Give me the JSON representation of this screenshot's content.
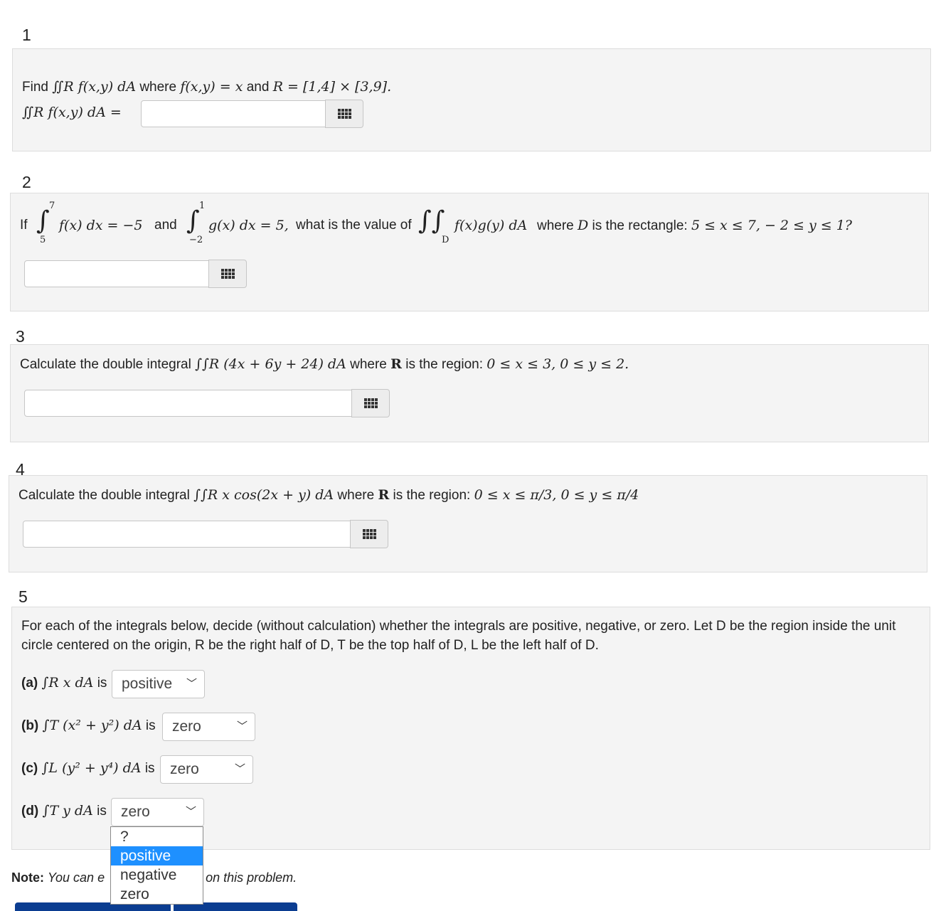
{
  "problems": {
    "p1": {
      "number": "1",
      "find": "Find",
      "integral_expr": "∬R f(x,y) dA",
      "where": "where",
      "f_def": "f(x,y) = x",
      "and": "and",
      "region": "R = [1,4] × [3,9].",
      "answer_prefix": "∬R f(x,y) dA =",
      "answer_value": ""
    },
    "p2": {
      "number": "2",
      "if": "If",
      "int1_upper": "7",
      "int1_lower": "5",
      "int1_body": "f(x) dx = −5",
      "and": "and",
      "int2_upper": "1",
      "int2_lower": "−2",
      "int2_body": "g(x) dx = 5,",
      "question": "what is the value of",
      "int3_sub": "D",
      "int3_body": "f(x)g(y) dA",
      "where_text": "where",
      "D": "D",
      "rect_text": "is the rectangle:",
      "ineq": "5 ≤ x ≤ 7,   − 2 ≤ y ≤ 1?",
      "answer_value": ""
    },
    "p3": {
      "number": "3",
      "lead": "Calculate the double integral",
      "integral": "∫∫R (4x + 6y + 24) dA",
      "where": "where",
      "R": "R",
      "region_text": "is the region:",
      "ineq": "0 ≤ x ≤ 3, 0 ≤ y ≤ 2.",
      "answer_value": ""
    },
    "p4": {
      "number": "4",
      "lead": "Calculate the double integral",
      "integral": "∫∫R x cos(2x + y) dA",
      "where": "where",
      "R": "R",
      "region_text": "is the region:",
      "ineq": "0 ≤ x ≤ π/3, 0 ≤ y ≤ π/4",
      "answer_value": ""
    },
    "p5": {
      "number": "5",
      "desc_line1": "For each of the integrals below, decide (without calculation) whether the integrals are positive, negative, or zero. Let D be the region inside the unit",
      "desc_line2": "circle centered on the origin, R be the right half of D, T be the top half of D, L be the left half of D.",
      "parts": [
        {
          "label": "(a)",
          "expr": "∫R x dA",
          "is": "is",
          "selected": "positive"
        },
        {
          "label": "(b)",
          "expr": "∫T (x² + y²) dA",
          "is": "is",
          "selected": "zero"
        },
        {
          "label": "(c)",
          "expr": "∫L (y² + y⁴) dA",
          "is": "is",
          "selected": "zero"
        },
        {
          "label": "(d)",
          "expr": "∫T y dA",
          "is": "is",
          "selected": "zero"
        }
      ],
      "options": [
        "?",
        "positive",
        "negative",
        "zero"
      ],
      "highlighted_option": "positive"
    }
  },
  "note": {
    "label": "Note:",
    "text_left": "You can e",
    "text_right": "it on this problem."
  },
  "icons": {
    "matrix": "grid-icon",
    "chevron": "chevron-down-icon"
  }
}
